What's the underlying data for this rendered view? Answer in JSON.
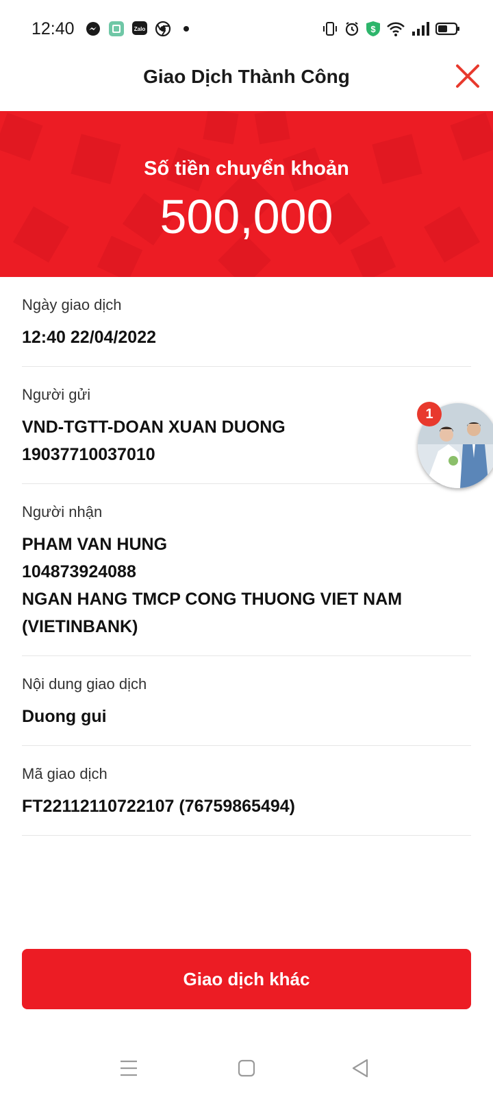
{
  "status_bar": {
    "time": "12:40",
    "notification_icons": [
      "messenger-icon",
      "app-icon",
      "zalo-icon",
      "chrome-icon",
      "dot-icon"
    ],
    "zalo_text": "Zalo",
    "system_icons": [
      "vibrate-icon",
      "alarm-icon",
      "shield-icon",
      "wifi-icon",
      "signal-icon",
      "battery-icon"
    ]
  },
  "header": {
    "title": "Giao Dịch Thành Công",
    "close_icon": "close-icon"
  },
  "banner": {
    "label": "Số tiền chuyển khoản",
    "amount": "500,000",
    "color": "#ec1c24"
  },
  "details": {
    "date": {
      "label": "Ngày giao dịch",
      "value": "12:40 22/04/2022"
    },
    "sender": {
      "label": "Người gửi",
      "name": "VND-TGTT-DOAN XUAN DUONG",
      "account": "19037710037010"
    },
    "receiver": {
      "label": "Người nhận",
      "name": "PHAM VAN HUNG",
      "account": "104873924088",
      "bank": "NGAN HANG TMCP CONG THUONG VIET NAM",
      "bank_short": "(VIETINBANK)"
    },
    "content": {
      "label": "Nội dung giao dịch",
      "value": "Duong gui"
    },
    "code": {
      "label": "Mã giao dịch",
      "value": "FT22112110722107 (76759865494)"
    }
  },
  "chathead": {
    "badge": "1"
  },
  "primary_button": {
    "label": "Giao dịch khác"
  },
  "navbar": {
    "icons": [
      "menu-icon",
      "home-icon",
      "back-icon"
    ]
  }
}
